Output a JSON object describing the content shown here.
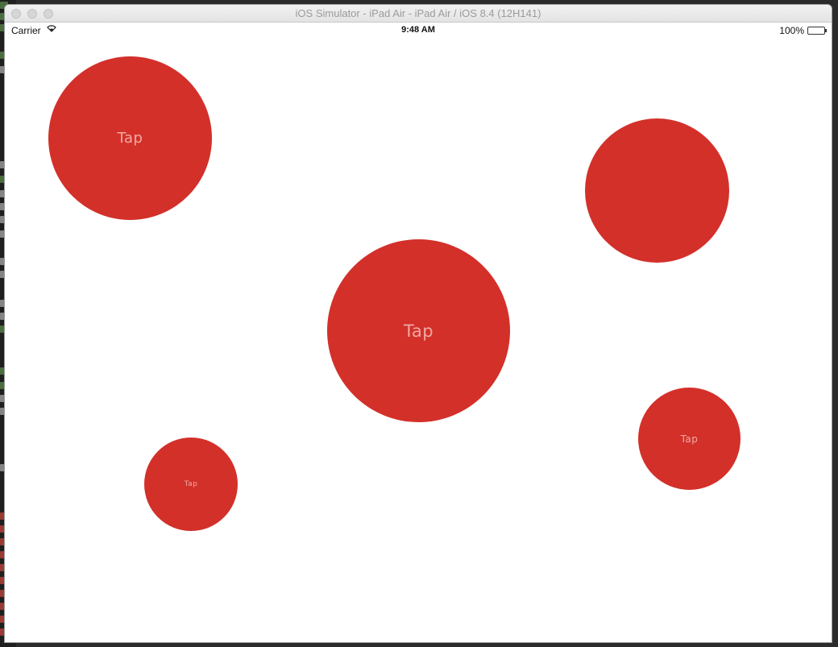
{
  "window": {
    "title": "iOS Simulator - iPad Air - iPad Air / iOS 8.4 (12H141)"
  },
  "status_bar": {
    "carrier": "Carrier",
    "time": "9:48 AM",
    "battery_percent": "100%"
  },
  "bubbles": [
    {
      "label": "Tap"
    },
    {
      "label": ""
    },
    {
      "label": "Tap"
    },
    {
      "label": "Tap"
    },
    {
      "label": "Tap"
    }
  ],
  "colors": {
    "bubble": "#d3302a",
    "bubble_text": "#f1a9a3"
  }
}
